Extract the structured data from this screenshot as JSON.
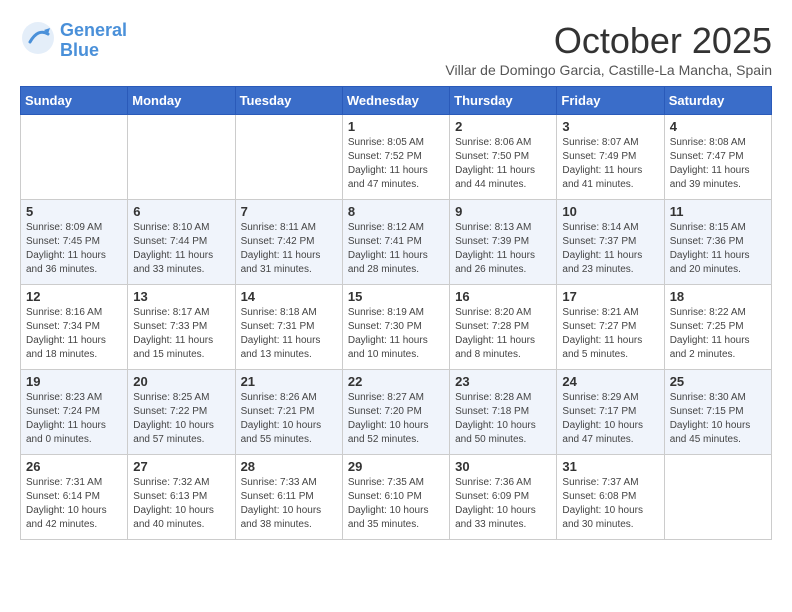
{
  "logo": {
    "line1": "General",
    "line2": "Blue"
  },
  "title": "October 2025",
  "subtitle": "Villar de Domingo Garcia, Castille-La Mancha, Spain",
  "days_of_week": [
    "Sunday",
    "Monday",
    "Tuesday",
    "Wednesday",
    "Thursday",
    "Friday",
    "Saturday"
  ],
  "weeks": [
    [
      {
        "day": "",
        "sunrise": "",
        "sunset": "",
        "daylight": ""
      },
      {
        "day": "",
        "sunrise": "",
        "sunset": "",
        "daylight": ""
      },
      {
        "day": "",
        "sunrise": "",
        "sunset": "",
        "daylight": ""
      },
      {
        "day": "1",
        "sunrise": "Sunrise: 8:05 AM",
        "sunset": "Sunset: 7:52 PM",
        "daylight": "Daylight: 11 hours and 47 minutes."
      },
      {
        "day": "2",
        "sunrise": "Sunrise: 8:06 AM",
        "sunset": "Sunset: 7:50 PM",
        "daylight": "Daylight: 11 hours and 44 minutes."
      },
      {
        "day": "3",
        "sunrise": "Sunrise: 8:07 AM",
        "sunset": "Sunset: 7:49 PM",
        "daylight": "Daylight: 11 hours and 41 minutes."
      },
      {
        "day": "4",
        "sunrise": "Sunrise: 8:08 AM",
        "sunset": "Sunset: 7:47 PM",
        "daylight": "Daylight: 11 hours and 39 minutes."
      }
    ],
    [
      {
        "day": "5",
        "sunrise": "Sunrise: 8:09 AM",
        "sunset": "Sunset: 7:45 PM",
        "daylight": "Daylight: 11 hours and 36 minutes."
      },
      {
        "day": "6",
        "sunrise": "Sunrise: 8:10 AM",
        "sunset": "Sunset: 7:44 PM",
        "daylight": "Daylight: 11 hours and 33 minutes."
      },
      {
        "day": "7",
        "sunrise": "Sunrise: 8:11 AM",
        "sunset": "Sunset: 7:42 PM",
        "daylight": "Daylight: 11 hours and 31 minutes."
      },
      {
        "day": "8",
        "sunrise": "Sunrise: 8:12 AM",
        "sunset": "Sunset: 7:41 PM",
        "daylight": "Daylight: 11 hours and 28 minutes."
      },
      {
        "day": "9",
        "sunrise": "Sunrise: 8:13 AM",
        "sunset": "Sunset: 7:39 PM",
        "daylight": "Daylight: 11 hours and 26 minutes."
      },
      {
        "day": "10",
        "sunrise": "Sunrise: 8:14 AM",
        "sunset": "Sunset: 7:37 PM",
        "daylight": "Daylight: 11 hours and 23 minutes."
      },
      {
        "day": "11",
        "sunrise": "Sunrise: 8:15 AM",
        "sunset": "Sunset: 7:36 PM",
        "daylight": "Daylight: 11 hours and 20 minutes."
      }
    ],
    [
      {
        "day": "12",
        "sunrise": "Sunrise: 8:16 AM",
        "sunset": "Sunset: 7:34 PM",
        "daylight": "Daylight: 11 hours and 18 minutes."
      },
      {
        "day": "13",
        "sunrise": "Sunrise: 8:17 AM",
        "sunset": "Sunset: 7:33 PM",
        "daylight": "Daylight: 11 hours and 15 minutes."
      },
      {
        "day": "14",
        "sunrise": "Sunrise: 8:18 AM",
        "sunset": "Sunset: 7:31 PM",
        "daylight": "Daylight: 11 hours and 13 minutes."
      },
      {
        "day": "15",
        "sunrise": "Sunrise: 8:19 AM",
        "sunset": "Sunset: 7:30 PM",
        "daylight": "Daylight: 11 hours and 10 minutes."
      },
      {
        "day": "16",
        "sunrise": "Sunrise: 8:20 AM",
        "sunset": "Sunset: 7:28 PM",
        "daylight": "Daylight: 11 hours and 8 minutes."
      },
      {
        "day": "17",
        "sunrise": "Sunrise: 8:21 AM",
        "sunset": "Sunset: 7:27 PM",
        "daylight": "Daylight: 11 hours and 5 minutes."
      },
      {
        "day": "18",
        "sunrise": "Sunrise: 8:22 AM",
        "sunset": "Sunset: 7:25 PM",
        "daylight": "Daylight: 11 hours and 2 minutes."
      }
    ],
    [
      {
        "day": "19",
        "sunrise": "Sunrise: 8:23 AM",
        "sunset": "Sunset: 7:24 PM",
        "daylight": "Daylight: 11 hours and 0 minutes."
      },
      {
        "day": "20",
        "sunrise": "Sunrise: 8:25 AM",
        "sunset": "Sunset: 7:22 PM",
        "daylight": "Daylight: 10 hours and 57 minutes."
      },
      {
        "day": "21",
        "sunrise": "Sunrise: 8:26 AM",
        "sunset": "Sunset: 7:21 PM",
        "daylight": "Daylight: 10 hours and 55 minutes."
      },
      {
        "day": "22",
        "sunrise": "Sunrise: 8:27 AM",
        "sunset": "Sunset: 7:20 PM",
        "daylight": "Daylight: 10 hours and 52 minutes."
      },
      {
        "day": "23",
        "sunrise": "Sunrise: 8:28 AM",
        "sunset": "Sunset: 7:18 PM",
        "daylight": "Daylight: 10 hours and 50 minutes."
      },
      {
        "day": "24",
        "sunrise": "Sunrise: 8:29 AM",
        "sunset": "Sunset: 7:17 PM",
        "daylight": "Daylight: 10 hours and 47 minutes."
      },
      {
        "day": "25",
        "sunrise": "Sunrise: 8:30 AM",
        "sunset": "Sunset: 7:15 PM",
        "daylight": "Daylight: 10 hours and 45 minutes."
      }
    ],
    [
      {
        "day": "26",
        "sunrise": "Sunrise: 7:31 AM",
        "sunset": "Sunset: 6:14 PM",
        "daylight": "Daylight: 10 hours and 42 minutes."
      },
      {
        "day": "27",
        "sunrise": "Sunrise: 7:32 AM",
        "sunset": "Sunset: 6:13 PM",
        "daylight": "Daylight: 10 hours and 40 minutes."
      },
      {
        "day": "28",
        "sunrise": "Sunrise: 7:33 AM",
        "sunset": "Sunset: 6:11 PM",
        "daylight": "Daylight: 10 hours and 38 minutes."
      },
      {
        "day": "29",
        "sunrise": "Sunrise: 7:35 AM",
        "sunset": "Sunset: 6:10 PM",
        "daylight": "Daylight: 10 hours and 35 minutes."
      },
      {
        "day": "30",
        "sunrise": "Sunrise: 7:36 AM",
        "sunset": "Sunset: 6:09 PM",
        "daylight": "Daylight: 10 hours and 33 minutes."
      },
      {
        "day": "31",
        "sunrise": "Sunrise: 7:37 AM",
        "sunset": "Sunset: 6:08 PM",
        "daylight": "Daylight: 10 hours and 30 minutes."
      },
      {
        "day": "",
        "sunrise": "",
        "sunset": "",
        "daylight": ""
      }
    ]
  ]
}
